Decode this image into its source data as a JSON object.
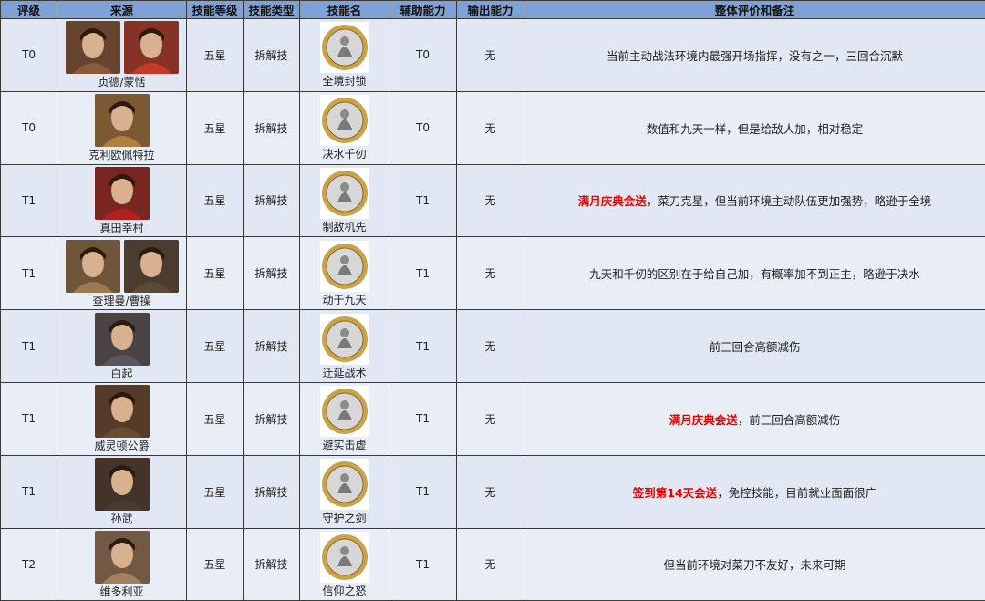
{
  "headers": {
    "tier": "评级",
    "source": "来源",
    "skill_level": "技能等级",
    "skill_type": "技能类型",
    "skill_name": "技能名",
    "support": "辅助能力",
    "output": "输出能力",
    "notes": "整体评价和备注"
  },
  "rows": [
    {
      "tier": "T0",
      "source": "贞德/蒙恬",
      "level": "五星",
      "type": "拆解技",
      "skill": "全境封锁",
      "support": "T0",
      "output": "无",
      "note_hl": "",
      "note": "当前主动战法环境内最强开场指挥，没有之一，三回合沉默",
      "colors": [
        "#8a5a3a",
        "#c43a2a"
      ]
    },
    {
      "tier": "T0",
      "source": "克利欧佩特拉",
      "level": "五星",
      "type": "拆解技",
      "skill": "决水千仞",
      "support": "T0",
      "output": "无",
      "note_hl": "",
      "note": "数值和九天一样，但是给敌人加，相对稳定",
      "colors": [
        "#b08040"
      ]
    },
    {
      "tier": "T1",
      "source": "真田幸村",
      "level": "五星",
      "type": "拆解技",
      "skill": "制敌机先",
      "support": "T1",
      "output": "无",
      "note_hl": "满月庆典会送",
      "note": "，菜刀克星，但当前环境主动队伍更加强势，略逊于全境",
      "colors": [
        "#b02020"
      ]
    },
    {
      "tier": "T1",
      "source": "查理曼/曹操",
      "level": "五星",
      "type": "拆解技",
      "skill": "动于九天",
      "support": "T1",
      "output": "无",
      "note_hl": "",
      "note": "九天和千仞的区别在于给自己加，有概率加不到正主，略逊于决水",
      "colors": [
        "#9a7a50",
        "#5a4a3a"
      ]
    },
    {
      "tier": "T1",
      "source": "白起",
      "level": "五星",
      "type": "拆解技",
      "skill": "迁延战术",
      "support": "T1",
      "output": "无",
      "note_hl": "",
      "note": "前三回合高额减伤",
      "colors": [
        "#5a5560"
      ]
    },
    {
      "tier": "T1",
      "source": "威灵顿公爵",
      "level": "五星",
      "type": "拆解技",
      "skill": "避实击虚",
      "support": "T1",
      "output": "无",
      "note_hl": "满月庆典会送",
      "note": "，前三回合高额减伤",
      "colors": [
        "#6a4a30"
      ]
    },
    {
      "tier": "T1",
      "source": "孙武",
      "level": "五星",
      "type": "拆解技",
      "skill": "守护之剑",
      "support": "T1",
      "output": "无",
      "note_hl": "签到第14天会送",
      "note": "，免控技能，目前就业面面很广",
      "colors": [
        "#4a3a30"
      ]
    },
    {
      "tier": "T2",
      "source": "维多利亚",
      "level": "五星",
      "type": "拆解技",
      "skill": "信仰之怒",
      "support": "T1",
      "output": "无",
      "note_hl": "",
      "note": "但当前环境对菜刀不友好，未来可期",
      "colors": [
        "#a08060"
      ]
    }
  ]
}
